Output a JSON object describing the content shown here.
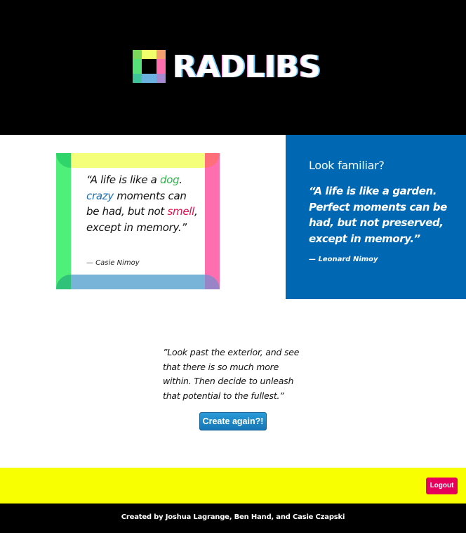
{
  "header": {
    "logo_text": "RADLIBS",
    "logo_icon": "radlibs-logo-icon"
  },
  "card": {
    "quote_open": "“A life is like a ",
    "word1": "dog",
    "after_word1": ". ",
    "word2": "crazy",
    "after_word2": " moments can be had, but not ",
    "word3": "smell",
    "after_word3": ", except in memory.”",
    "author": "— Casie Nimoy",
    "frame_colors": {
      "top": "#f4ff7a",
      "left": "#4ef07a",
      "right": "#ff6fb0",
      "bottom": "#78b4d8",
      "corner_tl": "#2fd56a",
      "corner_tr": "#ff6f7a",
      "corner_bl": "#2fc278",
      "corner_br": "#9a84c8"
    },
    "word_colors": {
      "word1": "#2fb24a",
      "word2": "#1f6fb4",
      "word3": "#e4104d"
    }
  },
  "familiar": {
    "title": "Look familiar?",
    "quote": "“A life is like a garden. Perfect moments can be had, but not preserved, except in memory.”",
    "author": "— Leonard Nimoy",
    "background": "#0068b2"
  },
  "inspiration": {
    "quote": "”Look past the exterior, and see that there is so much more within. Then decide to unleash that potential to the fullest.”"
  },
  "actions": {
    "create_again_label": "Create again?!",
    "logout_label": "Logout"
  },
  "footer": {
    "credits": "Created by Joshua Lagrange, Ben Hand, and Casie Czapski"
  },
  "colors": {
    "header_bg": "#000000",
    "yellow_bar": "#f7ff00",
    "logout_bg": "#e6005c",
    "button_blue": "#1a84c6"
  }
}
